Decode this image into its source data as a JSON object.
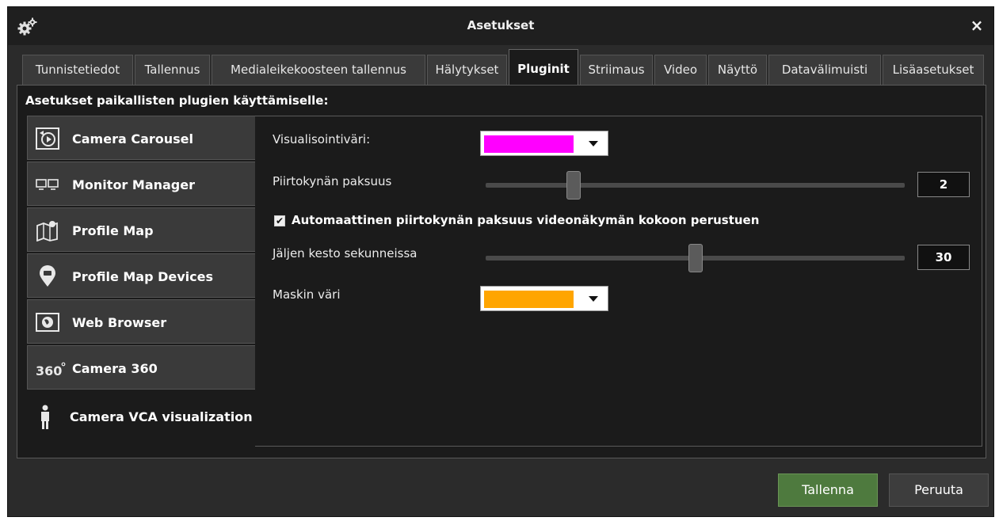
{
  "window": {
    "title": "Asetukset",
    "close_label": "×"
  },
  "tabs": [
    {
      "label": "Tunnistetiedot",
      "active": false
    },
    {
      "label": "Tallennus",
      "active": false
    },
    {
      "label": "Medialeikekoosteen tallennus",
      "active": false
    },
    {
      "label": "Hälytykset",
      "active": false
    },
    {
      "label": "Pluginit",
      "active": true
    },
    {
      "label": "Striimaus",
      "active": false
    },
    {
      "label": "Video",
      "active": false
    },
    {
      "label": "Näyttö",
      "active": false
    },
    {
      "label": "Datavälimuisti",
      "active": false
    },
    {
      "label": "Lisäasetukset",
      "active": false
    }
  ],
  "panel": {
    "heading": "Asetukset paikallisten plugien käyttämiselle:"
  },
  "plugins": [
    {
      "label": "Camera Carousel",
      "icon": "carousel-icon"
    },
    {
      "label": "Monitor Manager",
      "icon": "monitors-icon"
    },
    {
      "label": "Profile Map",
      "icon": "map-icon"
    },
    {
      "label": "Profile Map Devices",
      "icon": "map-pin-icon"
    },
    {
      "label": "Web Browser",
      "icon": "globe-icon"
    },
    {
      "label": "Camera 360",
      "icon": "360-icon"
    },
    {
      "label": "Camera VCA visualization",
      "icon": "person-icon",
      "active": true
    }
  ],
  "settings": {
    "visualization_color_label": "Visualisointiväri:",
    "visualization_color": "#ff00ff",
    "pen_width_label": "Piirtokynän paksuus",
    "pen_width_value": "2",
    "pen_width_fraction": 0.2,
    "auto_pen_label": "Automaattinen piirtokynän paksuus videonäkymän kokoon perustuen",
    "auto_pen_checked": true,
    "auto_pen_mark": "✔",
    "trail_duration_label": "Jäljen kesto sekunneissa",
    "trail_duration_value": "30",
    "trail_duration_fraction": 0.5,
    "mask_color_label": "Maskin väri",
    "mask_color": "#ffa500"
  },
  "buttons": {
    "save": "Tallenna",
    "cancel": "Peruuta"
  },
  "colors": {
    "save_button": "#4e7a3e",
    "background": "#1b1b1b"
  }
}
